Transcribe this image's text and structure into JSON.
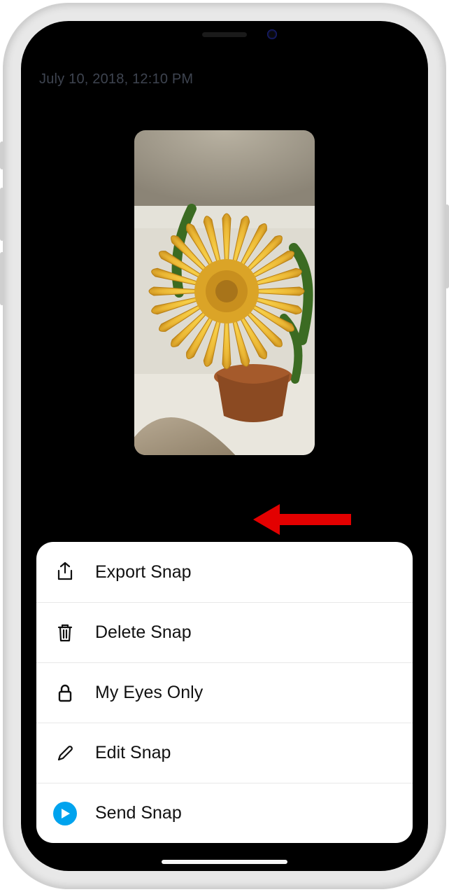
{
  "timestamp": "July 10, 2018, 12:10 PM",
  "menu": {
    "export": "Export Snap",
    "delete": "Delete Snap",
    "eyesOnly": "My Eyes Only",
    "edit": "Edit Snap",
    "send": "Send Snap"
  }
}
